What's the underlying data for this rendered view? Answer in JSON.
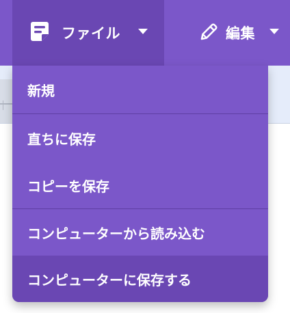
{
  "menubar": {
    "file": {
      "icon": "document-icon",
      "label": "ファイル"
    },
    "edit": {
      "icon": "pencil-icon",
      "label": "編集"
    }
  },
  "dropdown": {
    "items": [
      {
        "label": "新規"
      },
      {
        "label": "直ちに保存"
      },
      {
        "label": "コピーを保存"
      },
      {
        "label": "コンピューターから読み込む"
      },
      {
        "label": "コンピューターに保存する"
      }
    ]
  },
  "colors": {
    "menubar_bg": "#7b57c9",
    "active_bg": "#6a47b3",
    "text": "#ffffff",
    "separator": "#5f3fa3"
  }
}
